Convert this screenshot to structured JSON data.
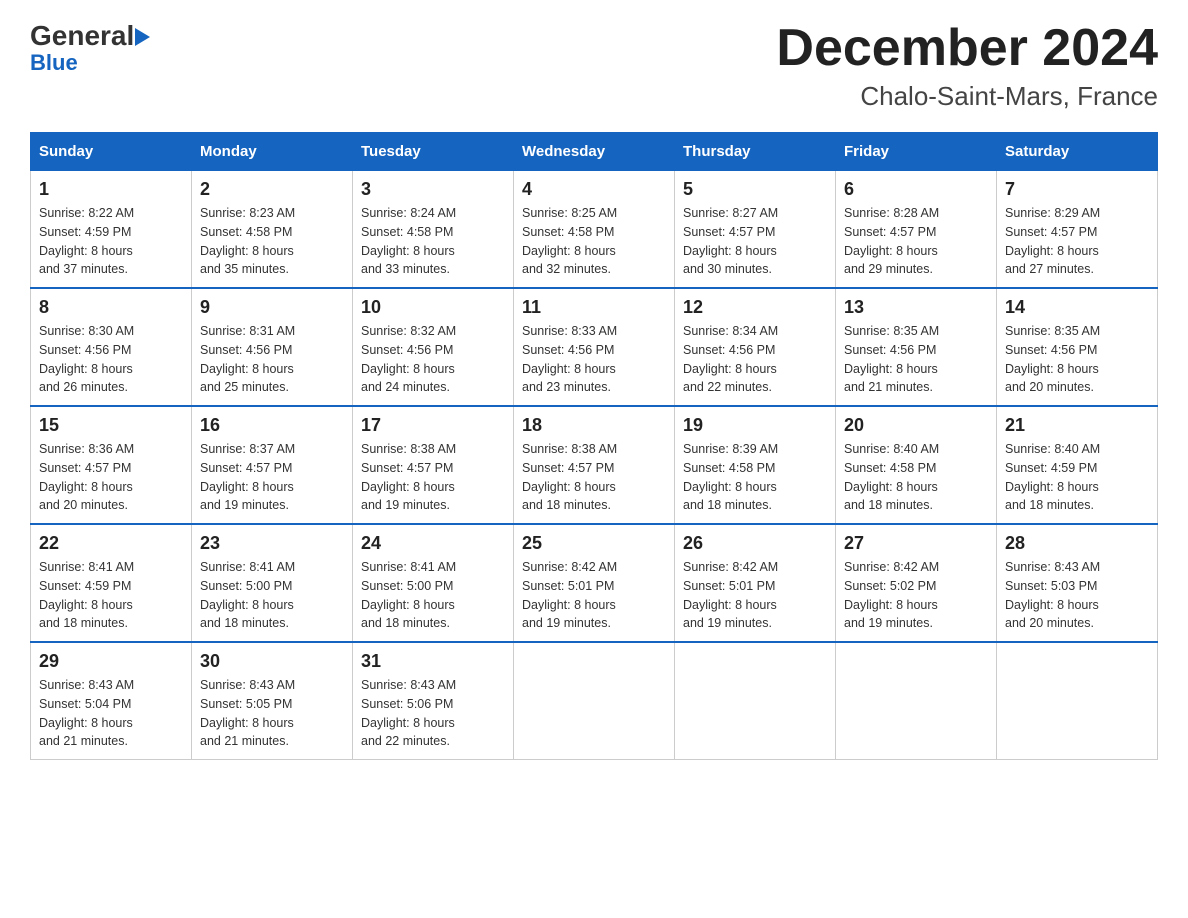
{
  "header": {
    "logo_general": "General",
    "logo_blue": "Blue",
    "month_title": "December 2024",
    "location": "Chalo-Saint-Mars, France"
  },
  "days_of_week": [
    "Sunday",
    "Monday",
    "Tuesday",
    "Wednesday",
    "Thursday",
    "Friday",
    "Saturday"
  ],
  "weeks": [
    [
      {
        "num": "1",
        "sunrise": "8:22 AM",
        "sunset": "4:59 PM",
        "daylight": "8 hours and 37 minutes."
      },
      {
        "num": "2",
        "sunrise": "8:23 AM",
        "sunset": "4:58 PM",
        "daylight": "8 hours and 35 minutes."
      },
      {
        "num": "3",
        "sunrise": "8:24 AM",
        "sunset": "4:58 PM",
        "daylight": "8 hours and 33 minutes."
      },
      {
        "num": "4",
        "sunrise": "8:25 AM",
        "sunset": "4:58 PM",
        "daylight": "8 hours and 32 minutes."
      },
      {
        "num": "5",
        "sunrise": "8:27 AM",
        "sunset": "4:57 PM",
        "daylight": "8 hours and 30 minutes."
      },
      {
        "num": "6",
        "sunrise": "8:28 AM",
        "sunset": "4:57 PM",
        "daylight": "8 hours and 29 minutes."
      },
      {
        "num": "7",
        "sunrise": "8:29 AM",
        "sunset": "4:57 PM",
        "daylight": "8 hours and 27 minutes."
      }
    ],
    [
      {
        "num": "8",
        "sunrise": "8:30 AM",
        "sunset": "4:56 PM",
        "daylight": "8 hours and 26 minutes."
      },
      {
        "num": "9",
        "sunrise": "8:31 AM",
        "sunset": "4:56 PM",
        "daylight": "8 hours and 25 minutes."
      },
      {
        "num": "10",
        "sunrise": "8:32 AM",
        "sunset": "4:56 PM",
        "daylight": "8 hours and 24 minutes."
      },
      {
        "num": "11",
        "sunrise": "8:33 AM",
        "sunset": "4:56 PM",
        "daylight": "8 hours and 23 minutes."
      },
      {
        "num": "12",
        "sunrise": "8:34 AM",
        "sunset": "4:56 PM",
        "daylight": "8 hours and 22 minutes."
      },
      {
        "num": "13",
        "sunrise": "8:35 AM",
        "sunset": "4:56 PM",
        "daylight": "8 hours and 21 minutes."
      },
      {
        "num": "14",
        "sunrise": "8:35 AM",
        "sunset": "4:56 PM",
        "daylight": "8 hours and 20 minutes."
      }
    ],
    [
      {
        "num": "15",
        "sunrise": "8:36 AM",
        "sunset": "4:57 PM",
        "daylight": "8 hours and 20 minutes."
      },
      {
        "num": "16",
        "sunrise": "8:37 AM",
        "sunset": "4:57 PM",
        "daylight": "8 hours and 19 minutes."
      },
      {
        "num": "17",
        "sunrise": "8:38 AM",
        "sunset": "4:57 PM",
        "daylight": "8 hours and 19 minutes."
      },
      {
        "num": "18",
        "sunrise": "8:38 AM",
        "sunset": "4:57 PM",
        "daylight": "8 hours and 18 minutes."
      },
      {
        "num": "19",
        "sunrise": "8:39 AM",
        "sunset": "4:58 PM",
        "daylight": "8 hours and 18 minutes."
      },
      {
        "num": "20",
        "sunrise": "8:40 AM",
        "sunset": "4:58 PM",
        "daylight": "8 hours and 18 minutes."
      },
      {
        "num": "21",
        "sunrise": "8:40 AM",
        "sunset": "4:59 PM",
        "daylight": "8 hours and 18 minutes."
      }
    ],
    [
      {
        "num": "22",
        "sunrise": "8:41 AM",
        "sunset": "4:59 PM",
        "daylight": "8 hours and 18 minutes."
      },
      {
        "num": "23",
        "sunrise": "8:41 AM",
        "sunset": "5:00 PM",
        "daylight": "8 hours and 18 minutes."
      },
      {
        "num": "24",
        "sunrise": "8:41 AM",
        "sunset": "5:00 PM",
        "daylight": "8 hours and 18 minutes."
      },
      {
        "num": "25",
        "sunrise": "8:42 AM",
        "sunset": "5:01 PM",
        "daylight": "8 hours and 19 minutes."
      },
      {
        "num": "26",
        "sunrise": "8:42 AM",
        "sunset": "5:01 PM",
        "daylight": "8 hours and 19 minutes."
      },
      {
        "num": "27",
        "sunrise": "8:42 AM",
        "sunset": "5:02 PM",
        "daylight": "8 hours and 19 minutes."
      },
      {
        "num": "28",
        "sunrise": "8:43 AM",
        "sunset": "5:03 PM",
        "daylight": "8 hours and 20 minutes."
      }
    ],
    [
      {
        "num": "29",
        "sunrise": "8:43 AM",
        "sunset": "5:04 PM",
        "daylight": "8 hours and 21 minutes."
      },
      {
        "num": "30",
        "sunrise": "8:43 AM",
        "sunset": "5:05 PM",
        "daylight": "8 hours and 21 minutes."
      },
      {
        "num": "31",
        "sunrise": "8:43 AM",
        "sunset": "5:06 PM",
        "daylight": "8 hours and 22 minutes."
      },
      null,
      null,
      null,
      null
    ]
  ],
  "labels": {
    "sunrise": "Sunrise:",
    "sunset": "Sunset:",
    "daylight": "Daylight:"
  }
}
